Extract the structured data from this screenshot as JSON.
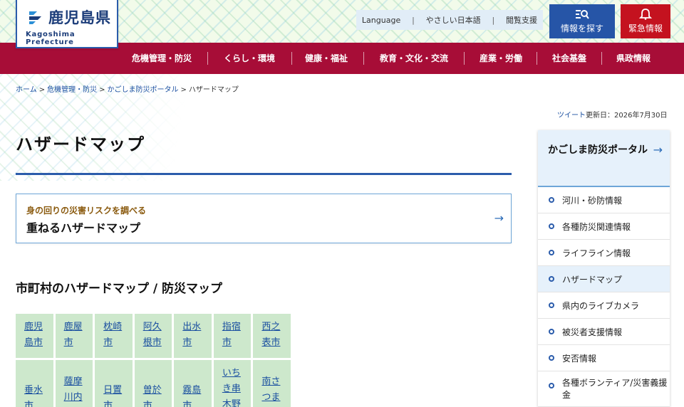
{
  "header": {
    "logo_title": "鹿児島県",
    "logo_subtitle": "Kagoshima Prefecture",
    "util_links": [
      "Language",
      "やさしい日本語",
      "閲覧支援"
    ],
    "search_label": "情報を探す",
    "emergency_label": "緊急情報"
  },
  "nav": {
    "items": [
      "危機管理・防災",
      "くらし・環境",
      "健康・福祉",
      "教育・文化・交流",
      "産業・労働",
      "社会基盤",
      "県政情報"
    ]
  },
  "breadcrumb": {
    "items": [
      "ホーム",
      "危機管理・防災",
      "かごしま防災ポータル"
    ],
    "current": "ハザードマップ",
    "separator": ">"
  },
  "meta": {
    "tweet_label": "ツイート",
    "updated": "更新日：2026年7月30日"
  },
  "page": {
    "title": "ハザードマップ",
    "card_subtitle": "身の回りの災害リスクを調べる",
    "card_title": "重ねるハザードマップ",
    "card_arrow": "→",
    "section_title": "市町村のハザードマップ / 防災マップ"
  },
  "municipalities": {
    "row1": [
      "鹿児島市",
      "鹿屋市",
      "枕崎市",
      "阿久根市",
      "出水市",
      "指宿市",
      "西之表市"
    ],
    "row2": [
      "垂水市",
      "薩摩川内",
      "日置市",
      "曽於市",
      "霧島市",
      "いちき串木野",
      "南さつま"
    ]
  },
  "sidebar": {
    "heading": "かごしま防災ポータル",
    "heading_arrow": "→",
    "items": [
      "河川・砂防情報",
      "各種防災関連情報",
      "ライフライン情報",
      "ハザードマップ",
      "県内のライブカメラ",
      "被災者支援情報",
      "安否情報",
      "各種ボランティア/災害義援金"
    ]
  },
  "colors": {
    "nav_bg": "#a70d37",
    "brand_blue": "#2655a7",
    "emergency_red": "#c4121f",
    "grid_green": "#cde8cc",
    "sidebar_active": "#e6f1fb"
  }
}
